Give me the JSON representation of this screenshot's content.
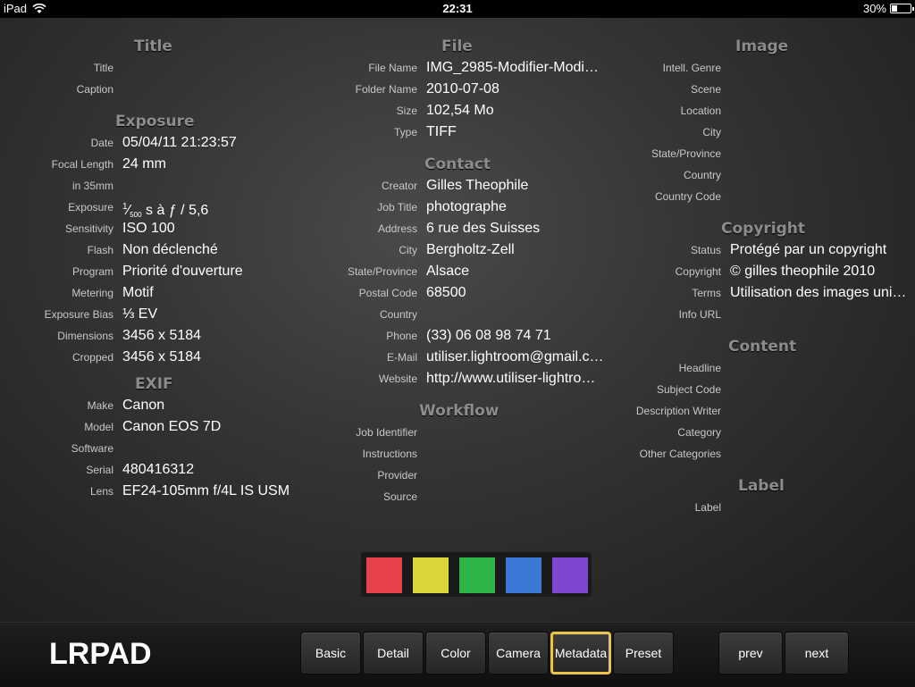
{
  "status_bar": {
    "device": "iPad",
    "time": "22:31",
    "battery": "30%",
    "battery_level": 0.3
  },
  "columns": {
    "title": {
      "heading": "Title",
      "rows": [
        {
          "label": "Title",
          "value": ""
        },
        {
          "label": "Caption",
          "value": ""
        }
      ]
    },
    "exposure": {
      "heading": "Exposure",
      "rows": [
        {
          "label": "Date",
          "value": "05/04/11 21:23:57"
        },
        {
          "label": "Focal Length",
          "value": "24 mm"
        },
        {
          "label": "in 35mm",
          "value": ""
        },
        {
          "label": "Exposure",
          "value_num": "1",
          "value_den": "500",
          "value_rest": " s à ƒ / 5,6"
        },
        {
          "label": "Sensitivity",
          "value": "ISO 100"
        },
        {
          "label": "Flash",
          "value": "Non déclenché"
        },
        {
          "label": "Program",
          "value": "Priorité d'ouverture"
        },
        {
          "label": "Metering",
          "value": "Motif"
        },
        {
          "label": "Exposure Bias",
          "value": "⅓ EV"
        },
        {
          "label": "Dimensions",
          "value": "3456 x 5184"
        },
        {
          "label": "Cropped",
          "value": "3456 x 5184"
        }
      ]
    },
    "exif": {
      "heading": "EXIF",
      "rows": [
        {
          "label": "Make",
          "value": "Canon"
        },
        {
          "label": "Model",
          "value": "Canon EOS 7D"
        },
        {
          "label": "Software",
          "value": ""
        },
        {
          "label": "Serial",
          "value": "480416312"
        },
        {
          "label": "Lens",
          "value": "EF24-105mm f/4L IS USM"
        }
      ]
    },
    "file": {
      "heading": "File",
      "rows": [
        {
          "label": "File Name",
          "value": "IMG_2985-Modifier-Modi…"
        },
        {
          "label": "Folder Name",
          "value": "2010-07-08"
        },
        {
          "label": "Size",
          "value": "102,54 Mo"
        },
        {
          "label": "Type",
          "value": "TIFF"
        }
      ]
    },
    "contact": {
      "heading": "Contact",
      "rows": [
        {
          "label": "Creator",
          "value": "Gilles Theophile"
        },
        {
          "label": "Job Title",
          "value": "photographe"
        },
        {
          "label": "Address",
          "value": "6 rue des Suisses"
        },
        {
          "label": "City",
          "value": "Bergholtz-Zell"
        },
        {
          "label": "State/Province",
          "value": "Alsace"
        },
        {
          "label": "Postal Code",
          "value": "68500"
        },
        {
          "label": "Country",
          "value": ""
        },
        {
          "label": "Phone",
          "value": "(33) 06 08 98 74 71"
        },
        {
          "label": "E-Mail",
          "value": "utiliser.lightroom@gmail.c…"
        },
        {
          "label": "Website",
          "value": "http://www.utiliser-lightro…"
        }
      ]
    },
    "workflow": {
      "heading": "Workflow",
      "rows": [
        {
          "label": "Job Identifier",
          "value": ""
        },
        {
          "label": "Instructions",
          "value": ""
        },
        {
          "label": "Provider",
          "value": ""
        },
        {
          "label": "Source",
          "value": ""
        }
      ]
    },
    "image": {
      "heading": "Image",
      "rows": [
        {
          "label": "Intell. Genre",
          "value": ""
        },
        {
          "label": "Scene",
          "value": ""
        },
        {
          "label": "Location",
          "value": ""
        },
        {
          "label": "City",
          "value": ""
        },
        {
          "label": "State/Province",
          "value": ""
        },
        {
          "label": "Country",
          "value": ""
        },
        {
          "label": "Country Code",
          "value": ""
        }
      ]
    },
    "copyright": {
      "heading": "Copyright",
      "rows": [
        {
          "label": "Status",
          "value": "Protégé par un copyright"
        },
        {
          "label": "Copyright",
          "value": "© gilles theophile 2010"
        },
        {
          "label": "Terms",
          "value": "Utilisation des images uni…"
        },
        {
          "label": "Info URL",
          "value": ""
        }
      ]
    },
    "content": {
      "heading": "Content",
      "rows": [
        {
          "label": "Headline",
          "value": ""
        },
        {
          "label": "Subject Code",
          "value": ""
        },
        {
          "label": "Description Writer",
          "value": ""
        },
        {
          "label": "Category",
          "value": ""
        },
        {
          "label": "Other Categories",
          "value": ""
        }
      ]
    },
    "label": {
      "heading": "Label",
      "rows": [
        {
          "label": "Label",
          "value": ""
        }
      ]
    }
  },
  "color_labels": [
    {
      "name": "red",
      "color": "#e8424a"
    },
    {
      "name": "yellow",
      "color": "#d9d63c"
    },
    {
      "name": "green",
      "color": "#2db54a"
    },
    {
      "name": "blue",
      "color": "#3a7ad6"
    },
    {
      "name": "purple",
      "color": "#7f47d0"
    }
  ],
  "toolbar": {
    "logo": "LRPAD",
    "tabs": [
      "Basic",
      "Detail",
      "Color",
      "Camera",
      "Metadata",
      "Preset"
    ],
    "active_tab": "Metadata",
    "prev": "prev",
    "next": "next",
    "accent": "#e9c44a"
  }
}
